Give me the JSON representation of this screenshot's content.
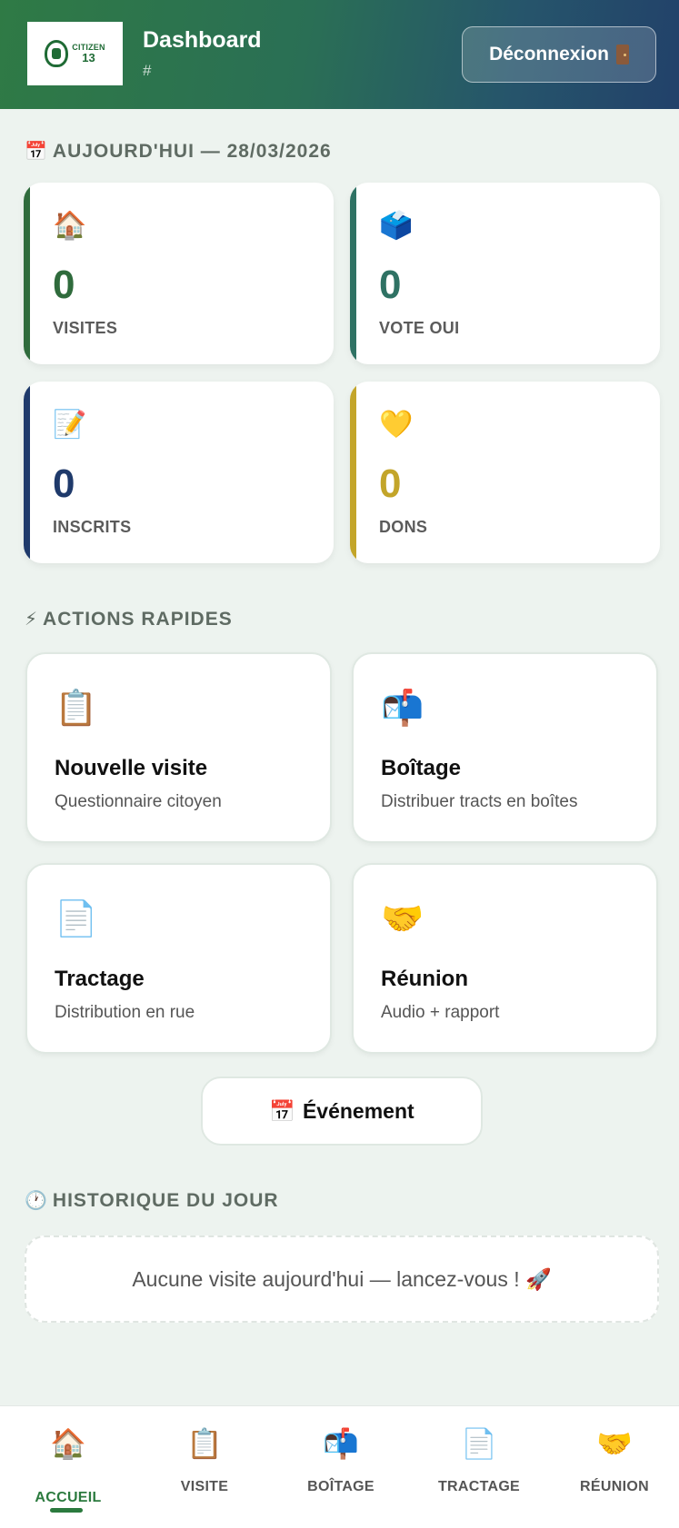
{
  "header": {
    "logo_text_1": "CITIZEN",
    "logo_text_2": "13",
    "title": "Dashboard",
    "subtitle": "#",
    "logout_label": "Déconnexion",
    "logout_icon": "door-icon"
  },
  "today": {
    "emoji": "📅",
    "title": "AUJOURD'HUI — 28/03/2026"
  },
  "stats": [
    {
      "emoji": "🏠",
      "icon": "house-icon",
      "value": "0",
      "label": "VISITES",
      "accent": "#2f6b3c"
    },
    {
      "emoji": "🗳️",
      "icon": "ballot-box-icon",
      "value": "0",
      "label": "VOTE OUI",
      "accent": "#2f7264"
    },
    {
      "emoji": "📝",
      "icon": "memo-icon",
      "value": "0",
      "label": "INSCRITS",
      "accent": "#1f3a6b"
    },
    {
      "emoji": "💛",
      "icon": "yellow-heart-icon",
      "value": "0",
      "label": "DONS",
      "accent": "#c3a52a"
    }
  ],
  "quick": {
    "emoji": "⚡",
    "title": "ACTIONS RAPIDES"
  },
  "actions": [
    {
      "emoji": "📋",
      "icon": "clipboard-icon",
      "title": "Nouvelle visite",
      "subtitle": "Questionnaire citoyen"
    },
    {
      "emoji": "📬",
      "icon": "mailbox-icon",
      "title": "Boîtage",
      "subtitle": "Distribuer tracts en boîtes"
    },
    {
      "emoji": "📄",
      "icon": "page-icon",
      "title": "Tractage",
      "subtitle": "Distribution en rue"
    },
    {
      "emoji": "🤝",
      "icon": "handshake-icon",
      "title": "Réunion",
      "subtitle": "Audio + rapport"
    }
  ],
  "event_button": {
    "emoji": "📅",
    "label": "Événement"
  },
  "history": {
    "emoji": "🕐",
    "title": "HISTORIQUE DU JOUR",
    "empty_text": "Aucune visite aujourd'hui — lancez-vous ! 🚀"
  },
  "nav": [
    {
      "emoji": "🏠",
      "icon": "house-icon",
      "label": "ACCUEIL",
      "active": true
    },
    {
      "emoji": "📋",
      "icon": "clipboard-icon",
      "label": "VISITE",
      "active": false
    },
    {
      "emoji": "📬",
      "icon": "mailbox-icon",
      "label": "BOÎTAGE",
      "active": false
    },
    {
      "emoji": "📄",
      "icon": "page-icon",
      "label": "TRACTAGE",
      "active": false
    },
    {
      "emoji": "🤝",
      "icon": "handshake-icon",
      "label": "RÉUNION",
      "active": false
    }
  ]
}
